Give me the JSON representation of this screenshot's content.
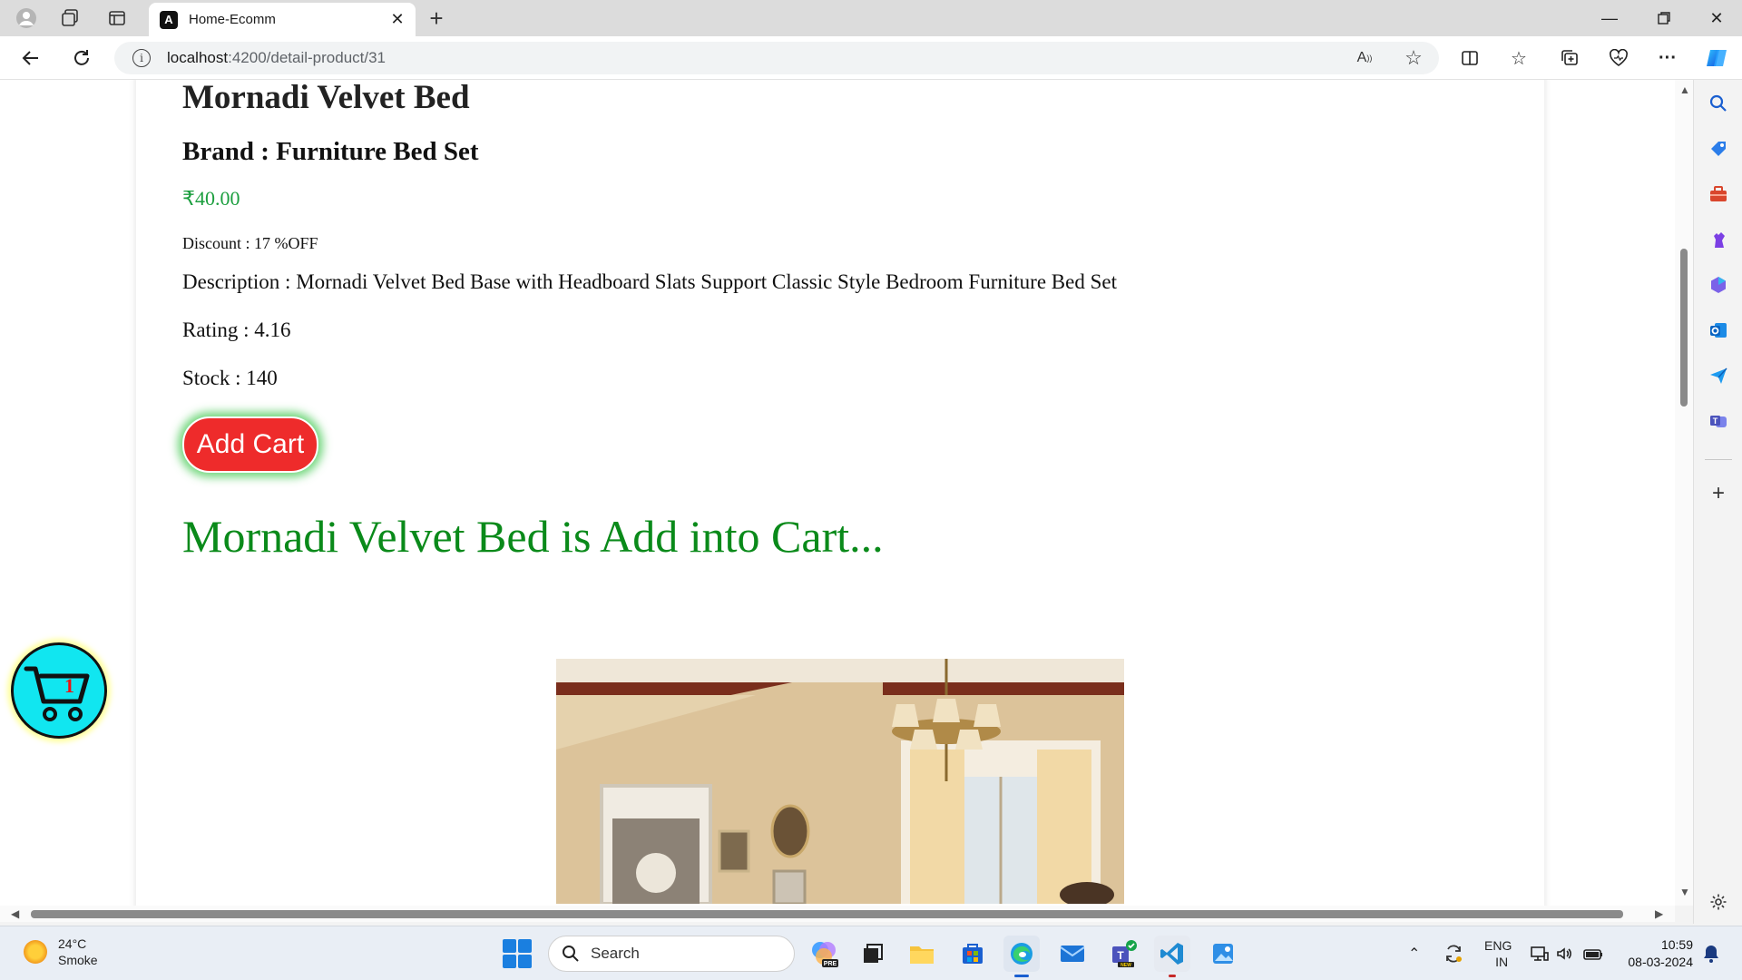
{
  "browser": {
    "tab_title": "Home-Ecomm",
    "url_host": "localhost",
    "url_path": ":4200/detail-product/31"
  },
  "product": {
    "name": "Mornadi Velvet Bed",
    "brand": "Brand : Furniture Bed Set",
    "price": "₹40.00",
    "discount": "Discount : 17 %OFF",
    "description": "Description : Mornadi Velvet Bed Base with Headboard Slats Support Classic Style Bedroom Furniture Bed Set",
    "rating": "Rating : 4.16",
    "stock": "Stock : 140",
    "add_button": "Add Cart",
    "added_message": "Mornadi Velvet Bed is Add into Cart..."
  },
  "cart": {
    "count": "1"
  },
  "taskbar": {
    "temperature": "24°C",
    "weather": "Smoke",
    "search_placeholder": "Search",
    "language": "ENG",
    "region": "IN",
    "time": "10:59",
    "date": "08-03-2024"
  },
  "colors": {
    "price": "#1b9e3e",
    "add_button": "#ee2b2b",
    "added_message": "#0a8a1a",
    "cart_badge": "#11e6f0"
  }
}
